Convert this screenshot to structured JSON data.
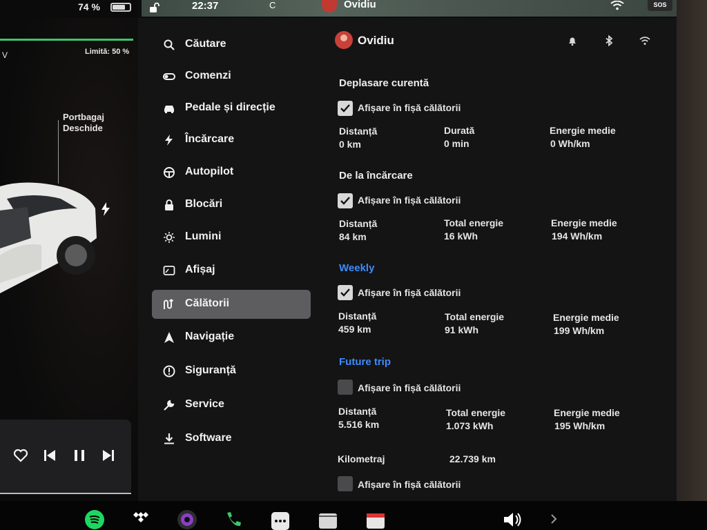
{
  "status": {
    "battery_percent": "74 %",
    "battery_level": 0.74,
    "time": "22:37",
    "temperature": "C",
    "user": "Ovidiu",
    "sos_label": "SOS"
  },
  "car_panel": {
    "gear": "V",
    "charge_limit": "Limită: 50 %",
    "trunk_line1": "Portbagaj",
    "trunk_line2": "Deschide"
  },
  "menu": {
    "items": [
      {
        "label": "Căutare",
        "icon": "search-icon"
      },
      {
        "label": "Comenzi",
        "icon": "toggle-icon"
      },
      {
        "label": "Pedale și direcție",
        "icon": "car-icon"
      },
      {
        "label": "Încărcare",
        "icon": "bolt-icon"
      },
      {
        "label": "Autopilot",
        "icon": "steering-wheel-icon"
      },
      {
        "label": "Blocări",
        "icon": "lock-icon"
      },
      {
        "label": "Lumini",
        "icon": "sun-icon"
      },
      {
        "label": "Afișaj",
        "icon": "display-icon"
      },
      {
        "label": "Călătorii",
        "icon": "trips-icon",
        "active": true
      },
      {
        "label": "Navigație",
        "icon": "navigation-icon"
      },
      {
        "label": "Siguranță",
        "icon": "alert-icon"
      },
      {
        "label": "Service",
        "icon": "wrench-icon"
      },
      {
        "label": "Software",
        "icon": "download-icon"
      }
    ]
  },
  "content": {
    "user_name": "Ovidiu",
    "show_in_trip_card": "Afișare în fișă călătorii",
    "sections": [
      {
        "title": "Deplasare curentă",
        "checked": true,
        "stats": [
          {
            "label": "Distanță",
            "value": "0 km"
          },
          {
            "label": "Durată",
            "value": "0 min"
          },
          {
            "label": "Energie medie",
            "value": "0 Wh/km"
          }
        ]
      },
      {
        "title": "De la încărcare",
        "checked": true,
        "stats": [
          {
            "label": "Distanță",
            "value": "84 km"
          },
          {
            "label": "Total energie",
            "value": "16 kWh"
          },
          {
            "label": "Energie medie",
            "value": "194 Wh/km"
          }
        ]
      },
      {
        "title": "Weekly",
        "checked": true,
        "stats": [
          {
            "label": "Distanță",
            "value": "459 km"
          },
          {
            "label": "Total energie",
            "value": "91 kWh"
          },
          {
            "label": "Energie medie",
            "value": "199 Wh/km"
          }
        ]
      },
      {
        "title": "Future trip",
        "checked": false,
        "stats": [
          {
            "label": "Distanță",
            "value": "5.516 km"
          },
          {
            "label": "Total energie",
            "value": "1.073 kWh"
          },
          {
            "label": "Energie medie",
            "value": "195 Wh/km"
          }
        ]
      }
    ],
    "odometer_label": "Kilometraj",
    "odometer_value": "22.739 km",
    "odometer_checked": false
  },
  "colors": {
    "accent_blue": "#3d8bfd",
    "charge_green": "#3ec46d",
    "active_menu": "#5d5d60"
  }
}
